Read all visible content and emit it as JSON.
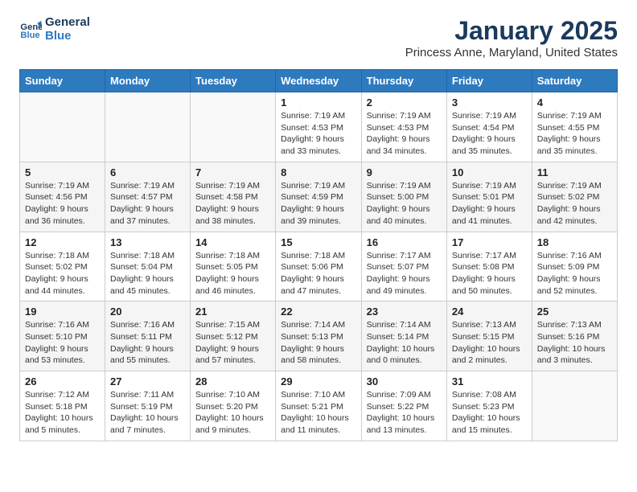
{
  "logo": {
    "line1": "General",
    "line2": "Blue"
  },
  "title": "January 2025",
  "subtitle": "Princess Anne, Maryland, United States",
  "weekdays": [
    "Sunday",
    "Monday",
    "Tuesday",
    "Wednesday",
    "Thursday",
    "Friday",
    "Saturday"
  ],
  "weeks": [
    [
      {
        "day": "",
        "detail": ""
      },
      {
        "day": "",
        "detail": ""
      },
      {
        "day": "",
        "detail": ""
      },
      {
        "day": "1",
        "detail": "Sunrise: 7:19 AM\nSunset: 4:53 PM\nDaylight: 9 hours\nand 33 minutes."
      },
      {
        "day": "2",
        "detail": "Sunrise: 7:19 AM\nSunset: 4:53 PM\nDaylight: 9 hours\nand 34 minutes."
      },
      {
        "day": "3",
        "detail": "Sunrise: 7:19 AM\nSunset: 4:54 PM\nDaylight: 9 hours\nand 35 minutes."
      },
      {
        "day": "4",
        "detail": "Sunrise: 7:19 AM\nSunset: 4:55 PM\nDaylight: 9 hours\nand 35 minutes."
      }
    ],
    [
      {
        "day": "5",
        "detail": "Sunrise: 7:19 AM\nSunset: 4:56 PM\nDaylight: 9 hours\nand 36 minutes."
      },
      {
        "day": "6",
        "detail": "Sunrise: 7:19 AM\nSunset: 4:57 PM\nDaylight: 9 hours\nand 37 minutes."
      },
      {
        "day": "7",
        "detail": "Sunrise: 7:19 AM\nSunset: 4:58 PM\nDaylight: 9 hours\nand 38 minutes."
      },
      {
        "day": "8",
        "detail": "Sunrise: 7:19 AM\nSunset: 4:59 PM\nDaylight: 9 hours\nand 39 minutes."
      },
      {
        "day": "9",
        "detail": "Sunrise: 7:19 AM\nSunset: 5:00 PM\nDaylight: 9 hours\nand 40 minutes."
      },
      {
        "day": "10",
        "detail": "Sunrise: 7:19 AM\nSunset: 5:01 PM\nDaylight: 9 hours\nand 41 minutes."
      },
      {
        "day": "11",
        "detail": "Sunrise: 7:19 AM\nSunset: 5:02 PM\nDaylight: 9 hours\nand 42 minutes."
      }
    ],
    [
      {
        "day": "12",
        "detail": "Sunrise: 7:18 AM\nSunset: 5:02 PM\nDaylight: 9 hours\nand 44 minutes."
      },
      {
        "day": "13",
        "detail": "Sunrise: 7:18 AM\nSunset: 5:04 PM\nDaylight: 9 hours\nand 45 minutes."
      },
      {
        "day": "14",
        "detail": "Sunrise: 7:18 AM\nSunset: 5:05 PM\nDaylight: 9 hours\nand 46 minutes."
      },
      {
        "day": "15",
        "detail": "Sunrise: 7:18 AM\nSunset: 5:06 PM\nDaylight: 9 hours\nand 47 minutes."
      },
      {
        "day": "16",
        "detail": "Sunrise: 7:17 AM\nSunset: 5:07 PM\nDaylight: 9 hours\nand 49 minutes."
      },
      {
        "day": "17",
        "detail": "Sunrise: 7:17 AM\nSunset: 5:08 PM\nDaylight: 9 hours\nand 50 minutes."
      },
      {
        "day": "18",
        "detail": "Sunrise: 7:16 AM\nSunset: 5:09 PM\nDaylight: 9 hours\nand 52 minutes."
      }
    ],
    [
      {
        "day": "19",
        "detail": "Sunrise: 7:16 AM\nSunset: 5:10 PM\nDaylight: 9 hours\nand 53 minutes."
      },
      {
        "day": "20",
        "detail": "Sunrise: 7:16 AM\nSunset: 5:11 PM\nDaylight: 9 hours\nand 55 minutes."
      },
      {
        "day": "21",
        "detail": "Sunrise: 7:15 AM\nSunset: 5:12 PM\nDaylight: 9 hours\nand 57 minutes."
      },
      {
        "day": "22",
        "detail": "Sunrise: 7:14 AM\nSunset: 5:13 PM\nDaylight: 9 hours\nand 58 minutes."
      },
      {
        "day": "23",
        "detail": "Sunrise: 7:14 AM\nSunset: 5:14 PM\nDaylight: 10 hours\nand 0 minutes."
      },
      {
        "day": "24",
        "detail": "Sunrise: 7:13 AM\nSunset: 5:15 PM\nDaylight: 10 hours\nand 2 minutes."
      },
      {
        "day": "25",
        "detail": "Sunrise: 7:13 AM\nSunset: 5:16 PM\nDaylight: 10 hours\nand 3 minutes."
      }
    ],
    [
      {
        "day": "26",
        "detail": "Sunrise: 7:12 AM\nSunset: 5:18 PM\nDaylight: 10 hours\nand 5 minutes."
      },
      {
        "day": "27",
        "detail": "Sunrise: 7:11 AM\nSunset: 5:19 PM\nDaylight: 10 hours\nand 7 minutes."
      },
      {
        "day": "28",
        "detail": "Sunrise: 7:10 AM\nSunset: 5:20 PM\nDaylight: 10 hours\nand 9 minutes."
      },
      {
        "day": "29",
        "detail": "Sunrise: 7:10 AM\nSunset: 5:21 PM\nDaylight: 10 hours\nand 11 minutes."
      },
      {
        "day": "30",
        "detail": "Sunrise: 7:09 AM\nSunset: 5:22 PM\nDaylight: 10 hours\nand 13 minutes."
      },
      {
        "day": "31",
        "detail": "Sunrise: 7:08 AM\nSunset: 5:23 PM\nDaylight: 10 hours\nand 15 minutes."
      },
      {
        "day": "",
        "detail": ""
      }
    ]
  ]
}
